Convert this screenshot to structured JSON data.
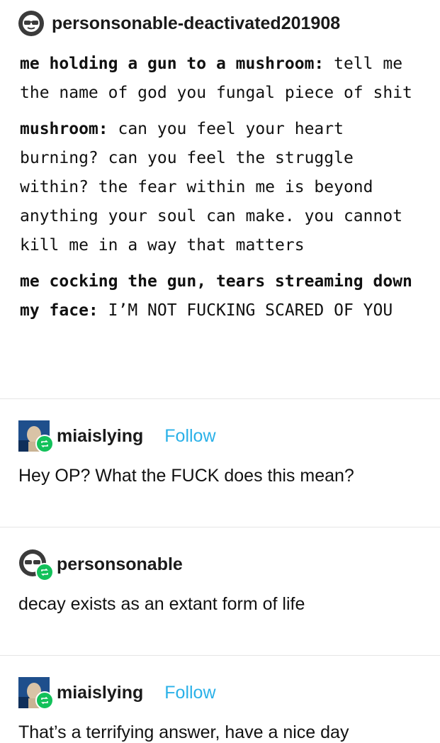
{
  "op": {
    "username": "personsonable-deactivated201908",
    "paragraphs": [
      {
        "speaker": "me holding a gun to a mushroom:",
        "text": " tell me the name of god you fungal piece of shit"
      },
      {
        "speaker": "mushroom:",
        "text": " can you feel your heart burning? can you feel the struggle within? the fear within me is beyond anything your soul can make. you cannot kill me in a way that matters"
      },
      {
        "speaker": "me cocking the gun, tears streaming down my face:",
        "text": " I’M NOT FUCKING SCARED OF YOU"
      }
    ]
  },
  "replies": [
    {
      "username": "miaislying",
      "follow_label": "Follow",
      "text": "Hey OP? What the FUCK does this mean?",
      "avatar": "stonks-man-avatar"
    },
    {
      "username": "personsonable",
      "follow_label": "",
      "text": "decay exists as an extant form of life",
      "avatar": "sunglasses-face-avatar"
    },
    {
      "username": "miaislying",
      "follow_label": "Follow",
      "text": "That’s a terrifying answer, have a nice day",
      "avatar": "stonks-man-avatar"
    }
  ]
}
